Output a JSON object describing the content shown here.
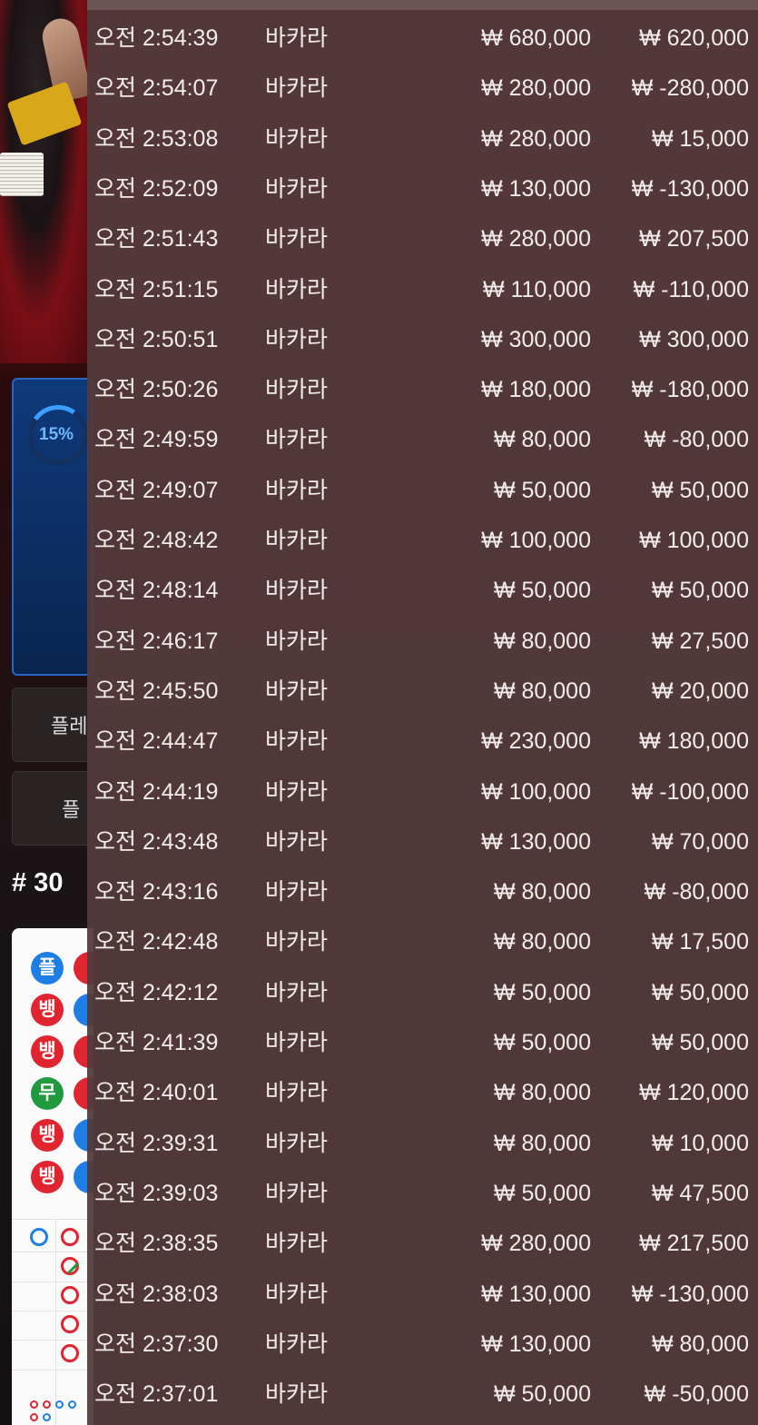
{
  "game_panel": {
    "progress_percent": "15%",
    "panel_label": "플",
    "button_1_label": "플레",
    "button_2_label": "플",
    "round_number": "# 30",
    "roadmap": [
      "플",
      "뱅",
      "뱅",
      "무",
      "뱅",
      "뱅"
    ]
  },
  "history": {
    "rows": [
      {
        "time": "오전 2:54:39",
        "game": "바카라",
        "bet": "₩ 680,000",
        "result": "₩ 620,000"
      },
      {
        "time": "오전 2:54:07",
        "game": "바카라",
        "bet": "₩ 280,000",
        "result": "₩ -280,000"
      },
      {
        "time": "오전 2:53:08",
        "game": "바카라",
        "bet": "₩ 280,000",
        "result": "₩ 15,000"
      },
      {
        "time": "오전 2:52:09",
        "game": "바카라",
        "bet": "₩ 130,000",
        "result": "₩ -130,000"
      },
      {
        "time": "오전 2:51:43",
        "game": "바카라",
        "bet": "₩ 280,000",
        "result": "₩ 207,500"
      },
      {
        "time": "오전 2:51:15",
        "game": "바카라",
        "bet": "₩ 110,000",
        "result": "₩ -110,000"
      },
      {
        "time": "오전 2:50:51",
        "game": "바카라",
        "bet": "₩ 300,000",
        "result": "₩ 300,000"
      },
      {
        "time": "오전 2:50:26",
        "game": "바카라",
        "bet": "₩ 180,000",
        "result": "₩ -180,000"
      },
      {
        "time": "오전 2:49:59",
        "game": "바카라",
        "bet": "₩ 80,000",
        "result": "₩ -80,000"
      },
      {
        "time": "오전 2:49:07",
        "game": "바카라",
        "bet": "₩ 50,000",
        "result": "₩ 50,000"
      },
      {
        "time": "오전 2:48:42",
        "game": "바카라",
        "bet": "₩ 100,000",
        "result": "₩ 100,000"
      },
      {
        "time": "오전 2:48:14",
        "game": "바카라",
        "bet": "₩ 50,000",
        "result": "₩ 50,000"
      },
      {
        "time": "오전 2:46:17",
        "game": "바카라",
        "bet": "₩ 80,000",
        "result": "₩ 27,500"
      },
      {
        "time": "오전 2:45:50",
        "game": "바카라",
        "bet": "₩ 80,000",
        "result": "₩ 20,000"
      },
      {
        "time": "오전 2:44:47",
        "game": "바카라",
        "bet": "₩ 230,000",
        "result": "₩ 180,000"
      },
      {
        "time": "오전 2:44:19",
        "game": "바카라",
        "bet": "₩ 100,000",
        "result": "₩ -100,000"
      },
      {
        "time": "오전 2:43:48",
        "game": "바카라",
        "bet": "₩ 130,000",
        "result": "₩ 70,000"
      },
      {
        "time": "오전 2:43:16",
        "game": "바카라",
        "bet": "₩ 80,000",
        "result": "₩ -80,000"
      },
      {
        "time": "오전 2:42:48",
        "game": "바카라",
        "bet": "₩ 80,000",
        "result": "₩ 17,500"
      },
      {
        "time": "오전 2:42:12",
        "game": "바카라",
        "bet": "₩ 50,000",
        "result": "₩ 50,000"
      },
      {
        "time": "오전 2:41:39",
        "game": "바카라",
        "bet": "₩ 50,000",
        "result": "₩ 50,000"
      },
      {
        "time": "오전 2:40:01",
        "game": "바카라",
        "bet": "₩ 80,000",
        "result": "₩ 120,000"
      },
      {
        "time": "오전 2:39:31",
        "game": "바카라",
        "bet": "₩ 80,000",
        "result": "₩ 10,000"
      },
      {
        "time": "오전 2:39:03",
        "game": "바카라",
        "bet": "₩ 50,000",
        "result": "₩ 47,500"
      },
      {
        "time": "오전 2:38:35",
        "game": "바카라",
        "bet": "₩ 280,000",
        "result": "₩ 217,500"
      },
      {
        "time": "오전 2:38:03",
        "game": "바카라",
        "bet": "₩ 130,000",
        "result": "₩ -130,000"
      },
      {
        "time": "오전 2:37:30",
        "game": "바카라",
        "bet": "₩ 130,000",
        "result": "₩ 80,000"
      },
      {
        "time": "오전 2:37:01",
        "game": "바카라",
        "bet": "₩ 50,000",
        "result": "₩ -50,000"
      }
    ]
  }
}
